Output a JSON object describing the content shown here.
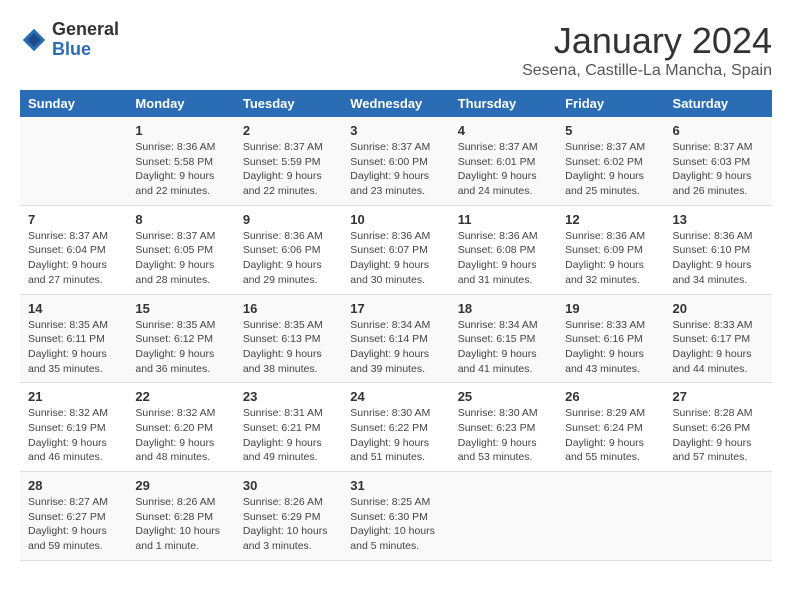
{
  "header": {
    "logo_general": "General",
    "logo_blue": "Blue",
    "title": "January 2024",
    "subtitle": "Sesena, Castille-La Mancha, Spain"
  },
  "days_of_week": [
    "Sunday",
    "Monday",
    "Tuesday",
    "Wednesday",
    "Thursday",
    "Friday",
    "Saturday"
  ],
  "weeks": [
    [
      {
        "day": "",
        "info": ""
      },
      {
        "day": "1",
        "info": "Sunrise: 8:36 AM\nSunset: 5:58 PM\nDaylight: 9 hours\nand 22 minutes."
      },
      {
        "day": "2",
        "info": "Sunrise: 8:37 AM\nSunset: 5:59 PM\nDaylight: 9 hours\nand 22 minutes."
      },
      {
        "day": "3",
        "info": "Sunrise: 8:37 AM\nSunset: 6:00 PM\nDaylight: 9 hours\nand 23 minutes."
      },
      {
        "day": "4",
        "info": "Sunrise: 8:37 AM\nSunset: 6:01 PM\nDaylight: 9 hours\nand 24 minutes."
      },
      {
        "day": "5",
        "info": "Sunrise: 8:37 AM\nSunset: 6:02 PM\nDaylight: 9 hours\nand 25 minutes."
      },
      {
        "day": "6",
        "info": "Sunrise: 8:37 AM\nSunset: 6:03 PM\nDaylight: 9 hours\nand 26 minutes."
      }
    ],
    [
      {
        "day": "7",
        "info": "Sunrise: 8:37 AM\nSunset: 6:04 PM\nDaylight: 9 hours\nand 27 minutes."
      },
      {
        "day": "8",
        "info": "Sunrise: 8:37 AM\nSunset: 6:05 PM\nDaylight: 9 hours\nand 28 minutes."
      },
      {
        "day": "9",
        "info": "Sunrise: 8:36 AM\nSunset: 6:06 PM\nDaylight: 9 hours\nand 29 minutes."
      },
      {
        "day": "10",
        "info": "Sunrise: 8:36 AM\nSunset: 6:07 PM\nDaylight: 9 hours\nand 30 minutes."
      },
      {
        "day": "11",
        "info": "Sunrise: 8:36 AM\nSunset: 6:08 PM\nDaylight: 9 hours\nand 31 minutes."
      },
      {
        "day": "12",
        "info": "Sunrise: 8:36 AM\nSunset: 6:09 PM\nDaylight: 9 hours\nand 32 minutes."
      },
      {
        "day": "13",
        "info": "Sunrise: 8:36 AM\nSunset: 6:10 PM\nDaylight: 9 hours\nand 34 minutes."
      }
    ],
    [
      {
        "day": "14",
        "info": "Sunrise: 8:35 AM\nSunset: 6:11 PM\nDaylight: 9 hours\nand 35 minutes."
      },
      {
        "day": "15",
        "info": "Sunrise: 8:35 AM\nSunset: 6:12 PM\nDaylight: 9 hours\nand 36 minutes."
      },
      {
        "day": "16",
        "info": "Sunrise: 8:35 AM\nSunset: 6:13 PM\nDaylight: 9 hours\nand 38 minutes."
      },
      {
        "day": "17",
        "info": "Sunrise: 8:34 AM\nSunset: 6:14 PM\nDaylight: 9 hours\nand 39 minutes."
      },
      {
        "day": "18",
        "info": "Sunrise: 8:34 AM\nSunset: 6:15 PM\nDaylight: 9 hours\nand 41 minutes."
      },
      {
        "day": "19",
        "info": "Sunrise: 8:33 AM\nSunset: 6:16 PM\nDaylight: 9 hours\nand 43 minutes."
      },
      {
        "day": "20",
        "info": "Sunrise: 8:33 AM\nSunset: 6:17 PM\nDaylight: 9 hours\nand 44 minutes."
      }
    ],
    [
      {
        "day": "21",
        "info": "Sunrise: 8:32 AM\nSunset: 6:19 PM\nDaylight: 9 hours\nand 46 minutes."
      },
      {
        "day": "22",
        "info": "Sunrise: 8:32 AM\nSunset: 6:20 PM\nDaylight: 9 hours\nand 48 minutes."
      },
      {
        "day": "23",
        "info": "Sunrise: 8:31 AM\nSunset: 6:21 PM\nDaylight: 9 hours\nand 49 minutes."
      },
      {
        "day": "24",
        "info": "Sunrise: 8:30 AM\nSunset: 6:22 PM\nDaylight: 9 hours\nand 51 minutes."
      },
      {
        "day": "25",
        "info": "Sunrise: 8:30 AM\nSunset: 6:23 PM\nDaylight: 9 hours\nand 53 minutes."
      },
      {
        "day": "26",
        "info": "Sunrise: 8:29 AM\nSunset: 6:24 PM\nDaylight: 9 hours\nand 55 minutes."
      },
      {
        "day": "27",
        "info": "Sunrise: 8:28 AM\nSunset: 6:26 PM\nDaylight: 9 hours\nand 57 minutes."
      }
    ],
    [
      {
        "day": "28",
        "info": "Sunrise: 8:27 AM\nSunset: 6:27 PM\nDaylight: 9 hours\nand 59 minutes."
      },
      {
        "day": "29",
        "info": "Sunrise: 8:26 AM\nSunset: 6:28 PM\nDaylight: 10 hours\nand 1 minute."
      },
      {
        "day": "30",
        "info": "Sunrise: 8:26 AM\nSunset: 6:29 PM\nDaylight: 10 hours\nand 3 minutes."
      },
      {
        "day": "31",
        "info": "Sunrise: 8:25 AM\nSunset: 6:30 PM\nDaylight: 10 hours\nand 5 minutes."
      },
      {
        "day": "",
        "info": ""
      },
      {
        "day": "",
        "info": ""
      },
      {
        "day": "",
        "info": ""
      }
    ]
  ]
}
